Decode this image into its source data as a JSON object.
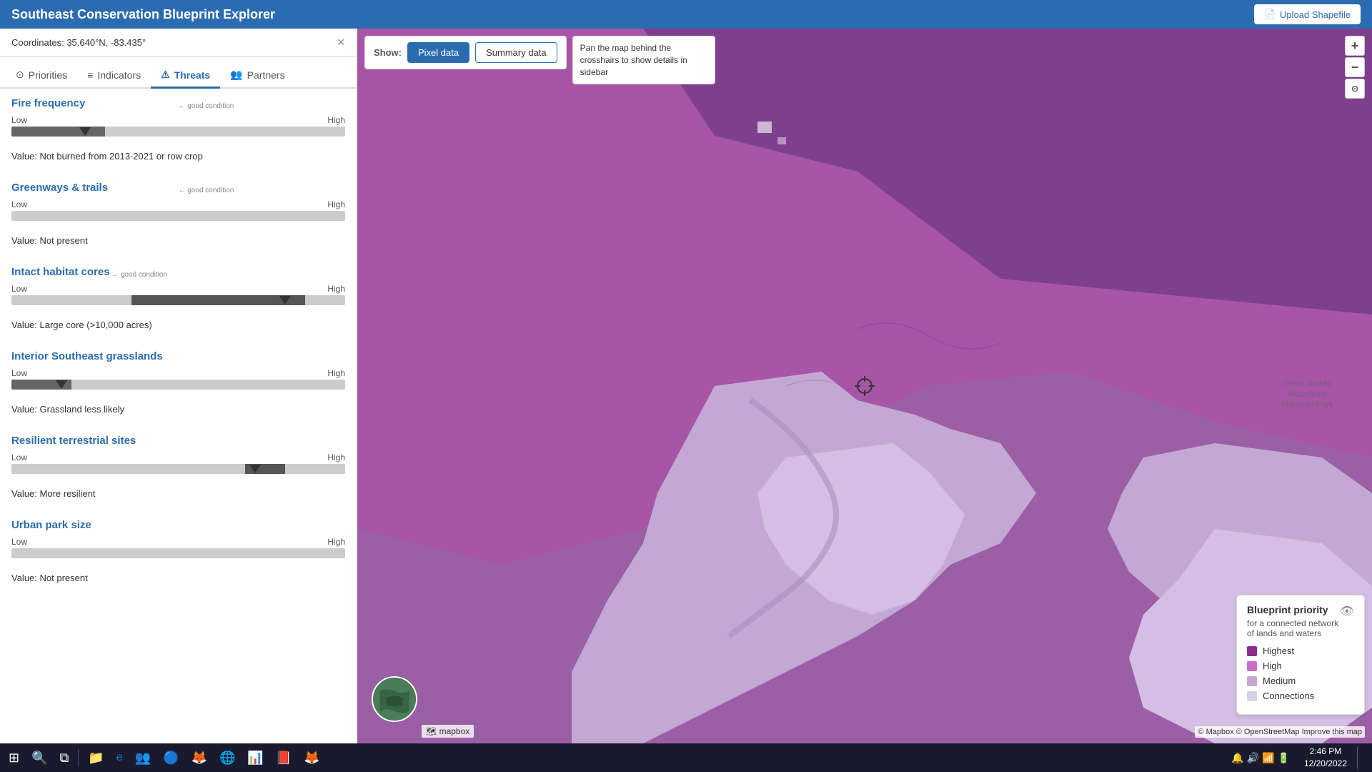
{
  "app": {
    "title": "Southeast Conservation Blueprint Explorer",
    "upload_btn": "Upload Shapefile"
  },
  "coords_bar": {
    "label": "Coordinates: 35.640°N, -83.435°",
    "close_icon": "✕"
  },
  "show_bar": {
    "label": "Show:",
    "btn_pixel": "Pixel data",
    "btn_summary": "Summary data",
    "tooltip": "Pan the map behind the crosshairs to show details in sidebar"
  },
  "nav_tabs": [
    {
      "id": "priorities",
      "label": "Priorities",
      "icon": "⊙"
    },
    {
      "id": "indicators",
      "label": "Indicators",
      "icon": "≡"
    },
    {
      "id": "threats",
      "label": "Threats",
      "icon": "⚠"
    },
    {
      "id": "partners",
      "label": "Partners",
      "icon": "👥"
    }
  ],
  "active_tab": "threats",
  "indicators": [
    {
      "id": "fire-frequency",
      "title": "Fire frequency",
      "low_label": "Low",
      "high_label": "High",
      "thumb_pct": 22,
      "good_condition_pct": 50,
      "gc_label": "← good condition",
      "value_label": "Value: Not burned from 2013-2021 or row crop",
      "track_type": "dark-left"
    },
    {
      "id": "greenways-trails",
      "title": "Greenways & trails",
      "low_label": "Low",
      "high_label": "High",
      "thumb_pct": null,
      "good_condition_pct": 50,
      "gc_label": "← good condition",
      "value_label": "Value: Not present",
      "track_type": "uniform"
    },
    {
      "id": "intact-habitat-cores",
      "title": "Intact habitat cores",
      "low_label": "Low",
      "high_label": "High",
      "thumb_pct": 82,
      "good_condition_pct": 28,
      "gc_label": "← good condition",
      "value_label": "Value: Large core (>10,000 acres)",
      "track_type": "dark-high"
    },
    {
      "id": "interior-se-grasslands",
      "title": "Interior Southeast grasslands",
      "low_label": "Low",
      "high_label": "High",
      "thumb_pct": 15,
      "good_condition_pct": null,
      "value_label": "Value: Grassland less likely",
      "track_type": "dark-left-sm"
    },
    {
      "id": "resilient-terrestrial-sites",
      "title": "Resilient terrestrial sites",
      "low_label": "Low",
      "high_label": "High",
      "thumb_pct": 73,
      "good_condition_pct": null,
      "value_label": "Value: More resilient",
      "track_type": "dark-high-sm"
    },
    {
      "id": "urban-park-size",
      "title": "Urban park size",
      "low_label": "Low",
      "high_label": "High",
      "thumb_pct": null,
      "good_condition_pct": null,
      "value_label": "Value: Not present",
      "track_type": "uniform"
    }
  ],
  "legend": {
    "title": "Blueprint priority",
    "subtitle": "for a connected network\nof lands and waters",
    "items": [
      {
        "label": "Highest",
        "color": "#8B2D8B"
      },
      {
        "label": "High",
        "color": "#C86FC8"
      },
      {
        "label": "Medium",
        "color": "#C8A8D8"
      },
      {
        "label": "Connections",
        "color": "#D8D0E8"
      }
    ]
  },
  "map_attr": "© Mapbox © OpenStreetMap  Improve this map",
  "mapbox_logo": "🗺 mapbox",
  "zoom": {
    "in": "+",
    "out": "−",
    "reset": "⊙"
  },
  "taskbar": {
    "clock_time": "2:46 PM",
    "clock_date": "12/20/2022",
    "start_icon": "⊞"
  }
}
